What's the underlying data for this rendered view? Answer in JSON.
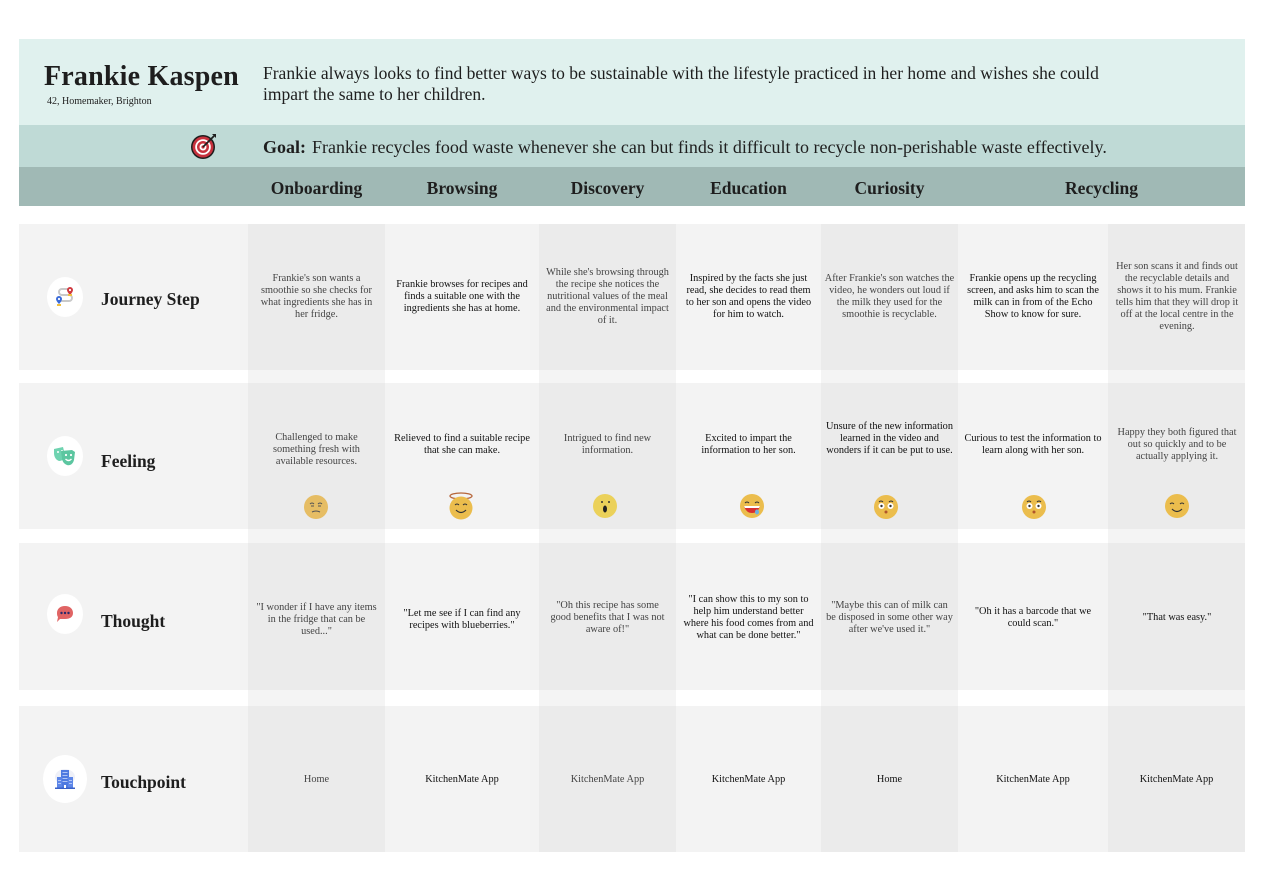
{
  "persona": {
    "name": "Frankie Kaspen",
    "meta": "42, Homemaker, Brighton",
    "bio": "Frankie always looks to find better ways to be sustainable with the lifestyle practiced in her home and wishes she could impart the same to her children."
  },
  "goal": {
    "icon": "target-icon",
    "label": "Goal:",
    "text": "Frankie recycles food waste whenever she can but finds it difficult to recycle non-perishable waste effectively."
  },
  "stages": [
    "Onboarding",
    "Browsing",
    "Discovery",
    "Education",
    "Curiosity",
    "Recycling"
  ],
  "rows": [
    {
      "title": "Journey Step",
      "icon": "route-map-icon",
      "cells": [
        "Frankie's son wants a smoothie so she checks for what ingredients she has in her fridge.",
        "Frankie browses for recipes and finds a suitable one with the ingredients she has at home.",
        "While she's browsing through the recipe she notices the nutritional values of the meal and the environmental impact of it.",
        "Inspired by the facts she just read, she decides to read them to her son and opens the video for him to watch.",
        "After Frankie's son watches the video, he wonders out loud if the milk they used for the smoothie is recyclable.",
        "Frankie opens up the recycling screen, and asks him to scan the milk can in from of the Echo Show to know for sure.",
        "Her son scans it and finds out the recyclable details and shows it to his mum. Frankie tells him that they will drop it off at the local centre in the evening."
      ]
    },
    {
      "title": "Feeling",
      "icon": "theater-masks-icon",
      "cells": [
        "Challenged to make something fresh with available resources.",
        "Relieved to find a suitable recipe that she can make.",
        "Intrigued to find new information.",
        "Excited to impart the information to her son.",
        "Unsure of the new information learned in the video and wonders if it can be put to use.",
        "Curious to test the information to learn along with her son.",
        "Happy they both figured that out so quickly and to be actually applying it."
      ],
      "emojis": [
        "skeptical-face-icon",
        "halo-smiling-face-icon",
        "surprised-face-icon",
        "laughing-face-icon",
        "flushed-face-icon",
        "flushed-face-icon",
        "content-smiling-face-icon"
      ]
    },
    {
      "title": "Thought",
      "icon": "speech-bubble-icon",
      "cells": [
        "\"I wonder if I have any items in the fridge that can be used...\"",
        "\"Let me see if I can find any recipes with blueberries.\"",
        "\"Oh this recipe has some good benefits that I was not aware of!\"",
        "\"I can show this to my son to help him understand better where his food comes from and what can be done better.\"",
        "\"Maybe this can of milk can be disposed in some other way after we've used it.\"",
        "\"Oh it has a barcode that we could scan.\"",
        "\"That was easy.\""
      ]
    },
    {
      "title": "Touchpoint",
      "icon": "building-icon",
      "cells": [
        "Home",
        "KitchenMate App",
        "KitchenMate App",
        "KitchenMate App",
        "Home",
        "KitchenMate App",
        "KitchenMate App"
      ]
    }
  ],
  "colors": {
    "header_bg": "#e0f1ee",
    "goal_bg": "#bfdad6",
    "stage_bg": "#a0b9b5",
    "cell_dark": "#ebebeb",
    "cell_light": "#f3f3f3",
    "emoji_yellow": "#ebbd4d"
  }
}
